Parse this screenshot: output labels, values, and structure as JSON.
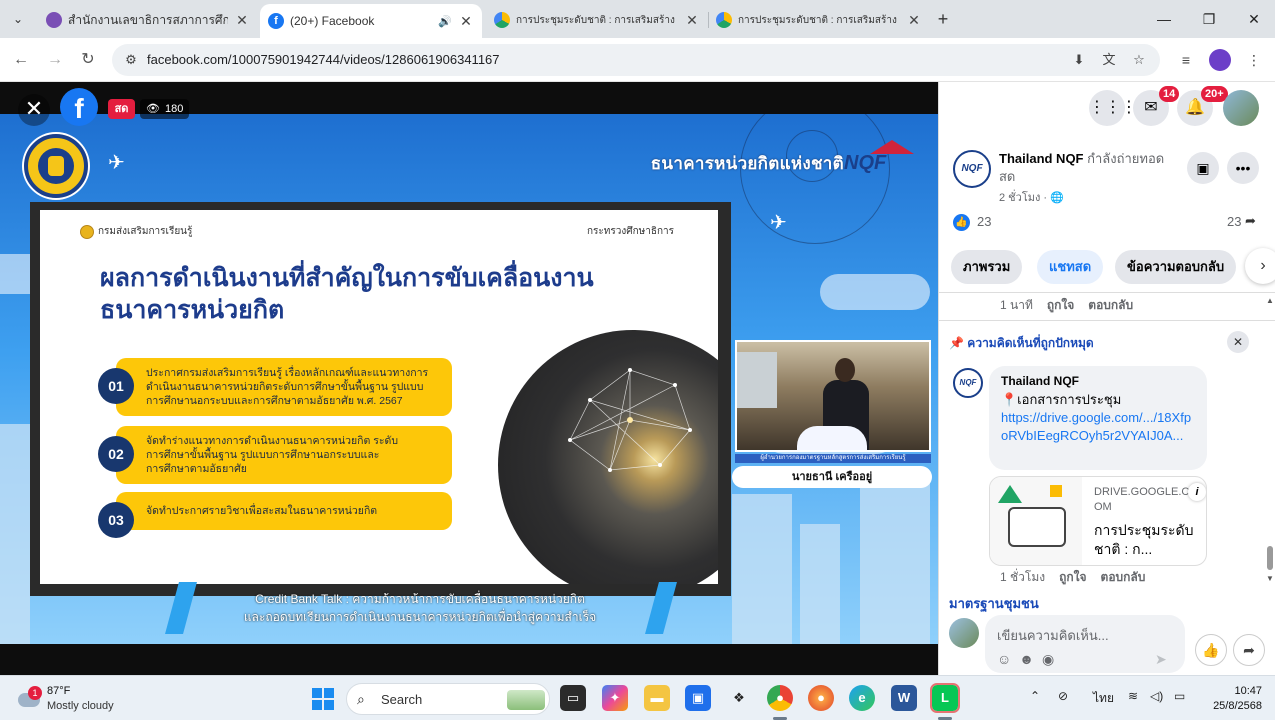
{
  "browser": {
    "tabs": [
      {
        "title": "สำนักงานเลขาธิการสภาการศึกษา :: ",
        "active": false
      },
      {
        "title": "(20+) Facebook",
        "active": true
      },
      {
        "title": "การประชุมระดับชาติ : การเสริมสร้าง",
        "active": false
      },
      {
        "title": "การประชุมระดับชาติ : การเสริมสร้าง",
        "active": false
      }
    ],
    "url": "facebook.com/100075901942744/videos/1286061906341167"
  },
  "video": {
    "live_label": "สด",
    "viewer_count": "180",
    "bank_title": "ธนาคารหน่วยกิตแห่งชาติ",
    "nqf_logo": "NQF",
    "slide": {
      "department": "กรมส่งเสริมการเรียนรู้",
      "ministry": "กระทรวงศึกษาธิการ",
      "headline_1": "ผลการดำเนินงานที่สำคัญในการขับเคลื่อนงาน",
      "headline_2": "ธนาคารหน่วยกิต",
      "items": [
        {
          "num": "01",
          "lines": [
            "ประกาศกรมส่งเสริมการเรียนรู้ เรื่องหลักเกณฑ์และแนวทางการ",
            "ดำเนินงานธนาคารหน่วยกิตระดับการศึกษาขั้นพื้นฐาน รูปแบบ",
            "การศึกษานอกระบบและการศึกษาตามอัธยาศัย พ.ศ. 2567"
          ]
        },
        {
          "num": "02",
          "lines": [
            "จัดทำร่างแนวทางการดำเนินงานธนาคารหน่วยกิต ระดับ",
            "การศึกษาขั้นพื้นฐาน รูปแบบการศึกษานอกระบบและ",
            "การศึกษาตามอัธยาศัย"
          ]
        },
        {
          "num": "03",
          "lines": [
            "จัดทำประกาศรายวิชาเพื่อสะสมในธนาคารหน่วยกิต"
          ]
        }
      ]
    },
    "speaker_caption": "ผู้อำนวยการกองมาตรฐานหลักสูตรการส่งเสริมการเรียนรู้",
    "speaker_name": "นายธานี เครืออยู่",
    "credit_line_1": "Credit Bank Talk : ความก้าวหน้าการขับเคลื่อนธนาคารหน่วยกิต",
    "credit_line_2": "และถอดบทเรียนการดำเนินงานธนาคารหน่วยกิตเพื่อนำสู่ความสำเร็จ"
  },
  "panel": {
    "messenger_badge": "14",
    "notif_badge": "20+",
    "page_name": "Thailand NQF",
    "page_status": "กำลังถ่ายทอดสด",
    "page_time": "2 ชั่วโมง · 🌐",
    "reactions": "23",
    "shares": "23",
    "chips": [
      "ภาพรวม",
      "แชทสด",
      "ข้อความตอบกลับ"
    ],
    "prev_comment_actions": {
      "time": "1 นาที",
      "like": "ถูกใจ",
      "reply": "ตอบกลับ"
    },
    "pinned_label": "ความคิดเห็นที่ถูกปักหมุด",
    "comment": {
      "author": "Thailand NQF",
      "doc_label": "📍เอกสารการประชุม",
      "link": "https://drive.google.com/.../18XfpoRVbIEegRCOyh5r2VYAIJ0A..."
    },
    "preview": {
      "domain": "DRIVE.GOOGLE.COM",
      "title": "การประชุมระดับชาติ : ก..."
    },
    "comment_actions": {
      "time": "1 ชั่วโมง",
      "like": "ถูกใจ",
      "reply": "ตอบกลับ"
    },
    "standard_title": "มาตรฐานชุมชน",
    "compose_placeholder": "เขียนความคิดเห็น..."
  },
  "taskbar": {
    "weather_badge": "1",
    "temp": "87°F",
    "weather_desc": "Mostly cloudy",
    "search_label": "Search",
    "lang": "ไทย",
    "time": "10:47",
    "date": "25/8/2568"
  },
  "colors": {
    "fb_blue": "#1877f2",
    "live_red": "#e41e3f",
    "slide_yellow": "#fdc709",
    "slide_navy": "#1d3c8c"
  }
}
